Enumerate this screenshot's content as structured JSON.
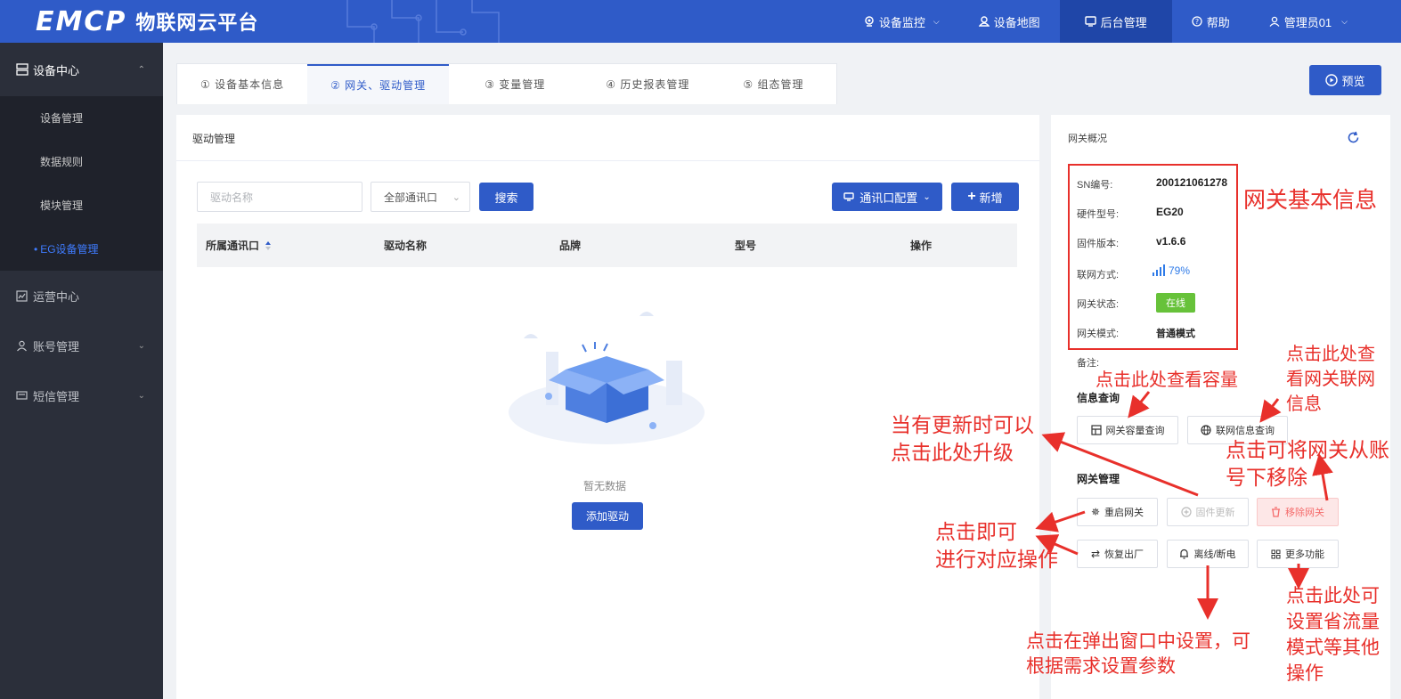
{
  "header": {
    "logo": "EMCP",
    "platform_name": "物联网云平台",
    "nav": [
      {
        "label": "设备监控",
        "icon": "camera-icon",
        "dropdown": true
      },
      {
        "label": "设备地图",
        "icon": "map-pin-icon",
        "dropdown": false
      },
      {
        "label": "后台管理",
        "icon": "monitor-icon",
        "dropdown": false,
        "active": true
      },
      {
        "label": "帮助",
        "icon": "help-icon",
        "dropdown": false
      },
      {
        "label": "管理员01",
        "icon": "user-icon",
        "dropdown": true
      }
    ]
  },
  "sidebar": {
    "device_center": "设备中心",
    "items": [
      "设备管理",
      "数据规则",
      "模块管理",
      "EG设备管理"
    ],
    "groups": [
      "运营中心",
      "账号管理",
      "短信管理"
    ]
  },
  "tabs": [
    "① 设备基本信息",
    "② 网关、驱动管理",
    "③ 变量管理",
    "④ 历史报表管理",
    "⑤ 组态管理"
  ],
  "preview_label": "预览",
  "driver": {
    "title": "驱动管理",
    "search_placeholder": "驱动名称",
    "port_select": "全部通讯口",
    "search_button": "搜索",
    "comm_config_button": "通讯口配置",
    "add_button": "新增",
    "columns": [
      "所属通讯口",
      "驱动名称",
      "品牌",
      "型号",
      "操作"
    ],
    "empty_text": "暂无数据",
    "add_driver_button": "添加驱动"
  },
  "gateway": {
    "title": "网关概况",
    "sn_label": "SN编号:",
    "sn_value": "200121061278",
    "hw_label": "硬件型号:",
    "hw_value": "EG20",
    "fw_label": "固件版本:",
    "fw_value": "v1.6.6",
    "net_label": "联网方式:",
    "net_value": "79%",
    "status_label": "网关状态:",
    "status_value": "在线",
    "mode_label": "网关模式:",
    "mode_value": "普通模式",
    "remark_label": "备注:",
    "query_title": "信息查询",
    "capacity_button": "网关容量查询",
    "netinfo_button": "联网信息查询",
    "manage_title": "网关管理",
    "restart_button": "重启网关",
    "firmware_button": "固件更新",
    "remove_button": "移除网关",
    "reset_button": "恢复出厂",
    "offline_button": "离线/断电",
    "more_button": "更多功能",
    "status_color": "#67c23a"
  },
  "annotations": {
    "basic_info": "网关基本信息",
    "capacity": "点击此处查看容量",
    "netinfo": "点击此处查\n看网关联网\n信息",
    "upgrade": "当有更新时可以\n点击此处升级",
    "remove": "点击可将网关从账\n号下移除",
    "operate": "点击即可\n进行对应操作",
    "popup": "点击在弹出窗口中设置，可\n根据需求设置参数",
    "more": "点击此处可\n设置省流量\n模式等其他\n操作"
  },
  "colors": {
    "primary": "#2f5bc8",
    "annotation": "#e8302b",
    "sidebar": "#2b2f3a"
  }
}
